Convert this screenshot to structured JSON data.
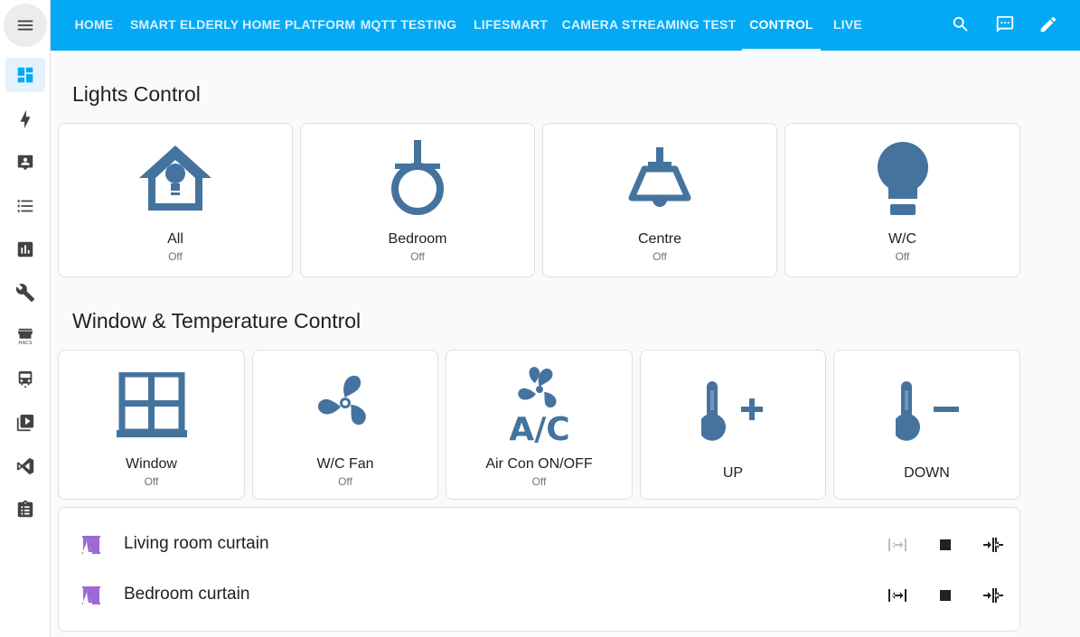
{
  "colors": {
    "header": "#03a9f4",
    "icon": "#44739e",
    "curtain": "#9c6ad3",
    "sidebar_icon": "#424242"
  },
  "sidebar": {
    "menu_icon": "menu-icon",
    "items": [
      {
        "icon": "dashboard-icon",
        "active": true
      },
      {
        "icon": "lightning-icon"
      },
      {
        "icon": "account-box-icon"
      },
      {
        "icon": "format-list-icon"
      },
      {
        "icon": "chart-box-icon"
      },
      {
        "icon": "wrench-icon"
      },
      {
        "icon": "hacs-store-icon"
      },
      {
        "icon": "bus-icon"
      },
      {
        "icon": "play-box-icon"
      },
      {
        "icon": "vscode-icon"
      },
      {
        "icon": "clipboard-list-icon"
      }
    ]
  },
  "header": {
    "tabs": [
      "HOME",
      "SMART ELDERLY HOME PLATFORM",
      "MQTT TESTING",
      "LIFESMART",
      "CAMERA STREAMING TEST",
      "CONTROL",
      "LIVE"
    ],
    "active_tab": "CONTROL",
    "actions": [
      "search-icon",
      "assist-chat-icon",
      "edit-pencil-icon"
    ]
  },
  "lights": {
    "title": "Lights Control",
    "cards": [
      {
        "name": "All",
        "state": "Off",
        "icon": "home-lightbulb-icon"
      },
      {
        "name": "Bedroom",
        "state": "Off",
        "icon": "ceiling-light-round-icon"
      },
      {
        "name": "Centre",
        "state": "Off",
        "icon": "ceiling-lamp-icon"
      },
      {
        "name": "W/C",
        "state": "Off",
        "icon": "lightbulb-icon"
      }
    ]
  },
  "window_temp": {
    "title": "Window & Temperature Control",
    "cards": [
      {
        "name": "Window",
        "state": "Off",
        "icon": "window-icon"
      },
      {
        "name": "W/C Fan",
        "state": "Off",
        "icon": "fan-icon"
      },
      {
        "name": "Air Con ON/OFF",
        "state": "Off",
        "icon": "air-conditioner-icon"
      },
      {
        "name": "UP",
        "state": "",
        "icon": "thermometer-plus-icon"
      },
      {
        "name": "DOWN",
        "state": "",
        "icon": "thermometer-minus-icon"
      }
    ]
  },
  "curtains": [
    {
      "name": "Living room curtain",
      "icon": "curtains-icon",
      "open_enabled": false
    },
    {
      "name": "Bedroom curtain",
      "icon": "curtains-icon",
      "open_enabled": true
    }
  ]
}
